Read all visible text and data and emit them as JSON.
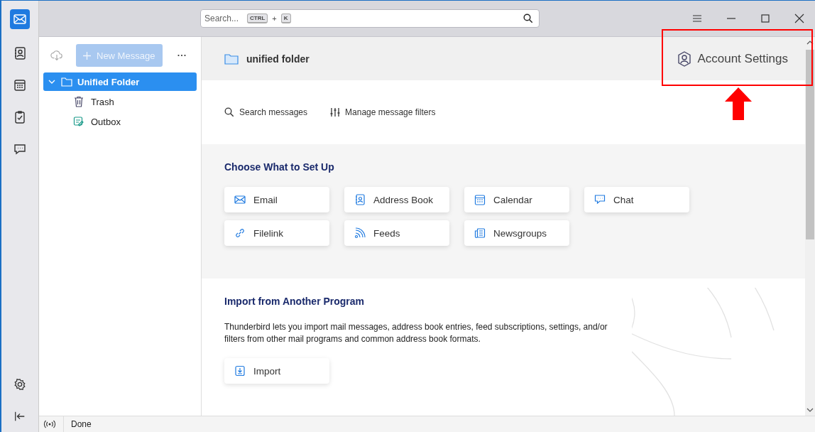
{
  "spaces_toolbar": {
    "items": [
      {
        "kind": "mail",
        "selected": true
      },
      {
        "kind": "address-book",
        "selected": false
      },
      {
        "kind": "calendar",
        "selected": false
      },
      {
        "kind": "tasks",
        "selected": false
      },
      {
        "kind": "chat",
        "selected": false
      }
    ],
    "bottom": [
      {
        "kind": "settings"
      },
      {
        "kind": "collapse"
      }
    ]
  },
  "title_bar": {
    "search": {
      "placeholder": "Search...",
      "shortcut_keys": [
        "CTRL",
        "K"
      ],
      "shortcut_separator": "+"
    }
  },
  "folder_pane": {
    "new_message": {
      "label": "New Message",
      "disabled": true
    },
    "folders": [
      {
        "name": "Unified Folder",
        "kind": "folder",
        "expanded": true,
        "selected": true,
        "children": [
          {
            "name": "Trash",
            "kind": "trash",
            "selected": false
          },
          {
            "name": "Outbox",
            "kind": "outbox",
            "selected": false
          }
        ]
      }
    ]
  },
  "content": {
    "folder_title": "unified folder",
    "account_settings": "Account Settings",
    "actions": [
      {
        "kind": "search",
        "label": "Search messages"
      },
      {
        "kind": "filters",
        "label": "Manage message filters"
      }
    ],
    "setup": {
      "title": "Choose What to Set Up",
      "buttons": [
        {
          "kind": "email",
          "label": "Email"
        },
        {
          "kind": "address-book",
          "label": "Address Book"
        },
        {
          "kind": "calendar",
          "label": "Calendar"
        },
        {
          "kind": "chat",
          "label": "Chat"
        },
        {
          "kind": "filelink",
          "label": "Filelink"
        },
        {
          "kind": "feeds",
          "label": "Feeds"
        },
        {
          "kind": "newsgroups",
          "label": "Newsgroups"
        }
      ]
    },
    "import": {
      "title": "Import from Another Program",
      "description": "Thunderbird lets you import mail messages, address book entries, feed subscriptions, settings, and/or filters from other mail programs and common address book formats.",
      "button": "Import"
    }
  },
  "status_bar": {
    "text": "Done"
  }
}
